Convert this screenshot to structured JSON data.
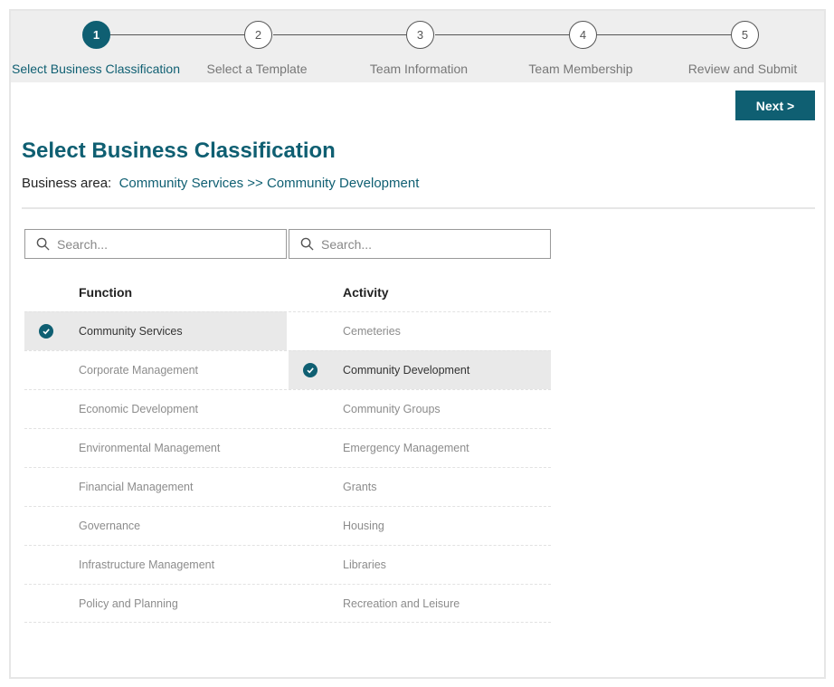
{
  "stepper": {
    "steps": [
      {
        "number": "1",
        "label": "Select Business Classification"
      },
      {
        "number": "2",
        "label": "Select a Template"
      },
      {
        "number": "3",
        "label": "Team Information"
      },
      {
        "number": "4",
        "label": "Team Membership"
      },
      {
        "number": "5",
        "label": "Review and Submit"
      }
    ]
  },
  "toolbar": {
    "next_label": "Next >"
  },
  "page": {
    "title": "Select Business Classification",
    "business_area_label": "Business area:",
    "business_area_value": "Community Services >> Community Development"
  },
  "function_column": {
    "search_placeholder": "Search...",
    "header": "Function",
    "items": [
      "Community Services",
      "Corporate Management",
      "Economic Development",
      "Environmental Management",
      "Financial Management",
      "Governance",
      "Infrastructure Management",
      "Policy and Planning"
    ],
    "selected": "Community Services"
  },
  "activity_column": {
    "search_placeholder": "Search...",
    "header": "Activity",
    "items": [
      "Cemeteries",
      "Community Development",
      "Community Groups",
      "Emergency Management",
      "Grants",
      "Housing",
      "Libraries",
      "Recreation and Leisure"
    ],
    "selected": "Community Development"
  },
  "colors": {
    "accent": "#0f5f72",
    "selected_row": "#e9e9e9",
    "stepper_bg": "#eeeeee"
  }
}
